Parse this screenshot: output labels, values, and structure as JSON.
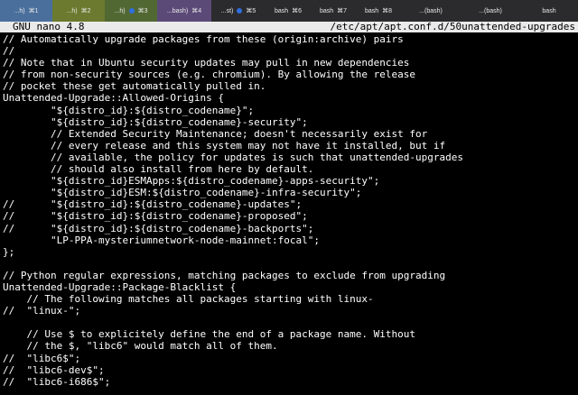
{
  "tabs": [
    {
      "label": "...h)",
      "shortcut": "⌘1",
      "bg": "#4a6f9c",
      "width": 58,
      "dot": false
    },
    {
      "label": "...h)",
      "shortcut": "⌘2",
      "bg": "#6b7a2e",
      "width": 58,
      "dot": false
    },
    {
      "label": "...h)",
      "shortcut": "⌘3",
      "bg": "#526833",
      "width": 58,
      "dot": true
    },
    {
      "label": "...bash)",
      "shortcut": "⌘4",
      "bg": "#5b4a78",
      "width": 60,
      "dot": false
    },
    {
      "label": "...st)",
      "shortcut": "⌘5",
      "bg": "#2b2b2e",
      "width": 60,
      "dot": true
    },
    {
      "label": "bash",
      "shortcut": "⌘6",
      "bg": "#2b2b2e",
      "width": 50,
      "dot": false
    },
    {
      "label": "bash",
      "shortcut": "⌘7",
      "bg": "#2b2b2e",
      "width": 50,
      "dot": false
    },
    {
      "label": "bash",
      "shortcut": "⌘8",
      "bg": "#2b2b2e",
      "width": 50,
      "dot": false
    },
    {
      "label": "...(bash)",
      "shortcut": "",
      "bg": "#2b2b2e",
      "width": 66,
      "dot": false
    },
    {
      "label": "...(bash)",
      "shortcut": "",
      "bg": "#2b2b2e",
      "width": 66,
      "dot": false
    },
    {
      "label": "bash",
      "shortcut": "",
      "bg": "#2b2b2e",
      "width": 64,
      "dot": false
    }
  ],
  "titlebar": {
    "app": "GNU nano 4.8",
    "file": "/etc/apt/apt.conf.d/50unattended-upgrades"
  },
  "lines": [
    "// Automatically upgrade packages from these (origin:archive) pairs",
    "//",
    "// Note that in Ubuntu security updates may pull in new dependencies",
    "// from non-security sources (e.g. chromium). By allowing the release",
    "// pocket these get automatically pulled in.",
    "Unattended-Upgrade::Allowed-Origins {",
    "        \"${distro_id}:${distro_codename}\";",
    "        \"${distro_id}:${distro_codename}-security\";",
    "        // Extended Security Maintenance; doesn't necessarily exist for",
    "        // every release and this system may not have it installed, but if",
    "        // available, the policy for updates is such that unattended-upgrades",
    "        // should also install from here by default.",
    "        \"${distro_id}ESMApps:${distro_codename}-apps-security\";",
    "        \"${distro_id}ESM:${distro_codename}-infra-security\";",
    "//      \"${distro_id}:${distro_codename}-updates\";",
    "//      \"${distro_id}:${distro_codename}-proposed\";",
    "//      \"${distro_id}:${distro_codename}-backports\";",
    "        \"LP-PPA-mysteriumnetwork-node-mainnet:focal\";",
    "};",
    "",
    "// Python regular expressions, matching packages to exclude from upgrading",
    "Unattended-Upgrade::Package-Blacklist {",
    "    // The following matches all packages starting with linux-",
    "//  \"linux-\";",
    "",
    "    // Use $ to explicitely define the end of a package name. Without",
    "    // the $, \"libc6\" would match all of them.",
    "//  \"libc6$\";",
    "//  \"libc6-dev$\";",
    "//  \"libc6-i686$\";"
  ]
}
